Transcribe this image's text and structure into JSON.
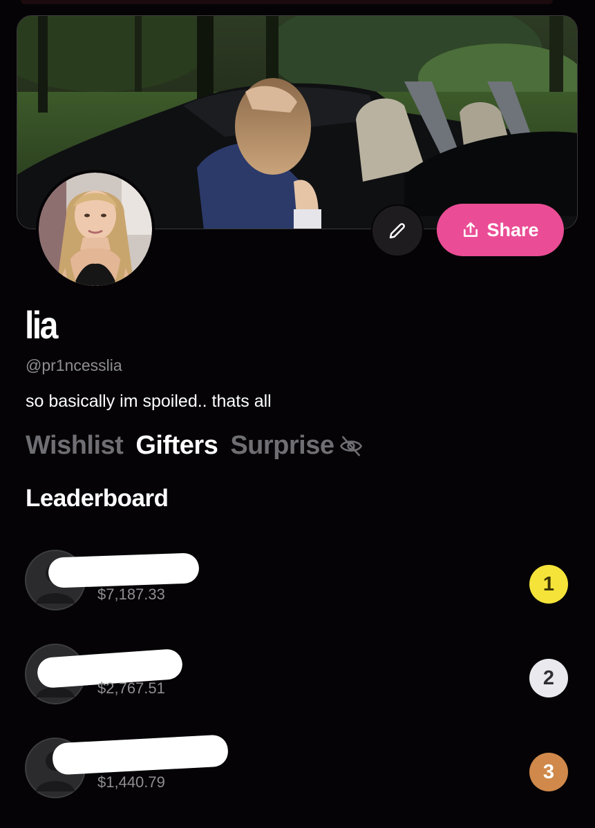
{
  "profile": {
    "display_name": "lia",
    "handle": "@pr1ncesslia",
    "bio": "so basically im spoiled.. thats all",
    "share_label": "Share"
  },
  "tabs": [
    {
      "label": "Wishlist",
      "active": false
    },
    {
      "label": "Gifters",
      "active": true
    },
    {
      "label": "Surprise",
      "active": false,
      "icon": "eye-slash-icon"
    }
  ],
  "leaderboard": {
    "title": "Leaderboard",
    "entries": [
      {
        "rank": "1",
        "amount": "$7,187.33",
        "badge_color": "#f5e33a"
      },
      {
        "rank": "2",
        "amount": "$2,767.51",
        "badge_color": "#e9e9ee"
      },
      {
        "rank": "3",
        "amount": "$1,440.79",
        "badge_color": "#d0894a"
      }
    ]
  },
  "colors": {
    "accent": "#ea4d95",
    "background": "#050306",
    "muted_text": "#8e8e93"
  },
  "icons": {
    "edit": "pencil-icon",
    "share": "share-icon",
    "hidden": "eye-slash-icon",
    "default_avatar": "user-placeholder-icon"
  }
}
